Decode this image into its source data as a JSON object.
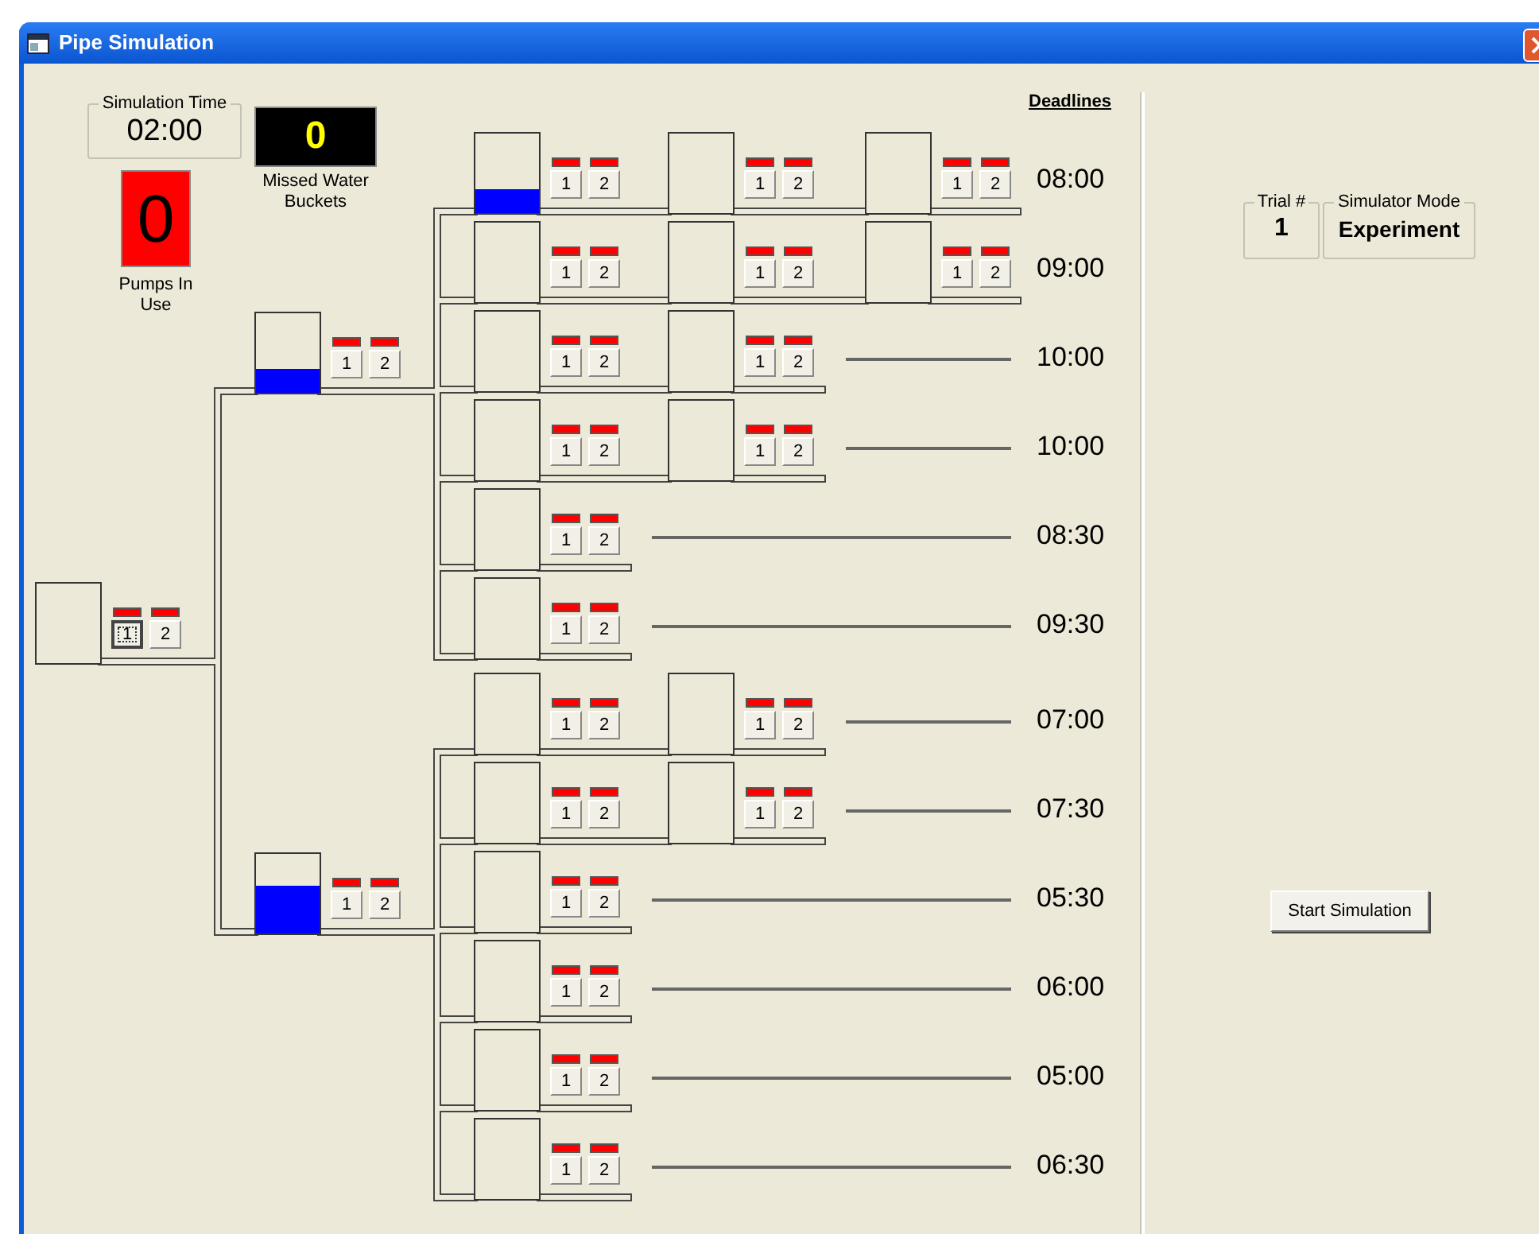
{
  "window": {
    "title": "Pipe Simulation"
  },
  "simulation_time": {
    "label": "Simulation Time",
    "value": "02:00"
  },
  "missed_water_buckets": {
    "value": "0",
    "label": "Missed Water Buckets"
  },
  "pumps_in_use": {
    "value": "0",
    "label": "Pumps In Use"
  },
  "deadlines_header": "Deadlines",
  "network": {
    "level": 0,
    "pumps": [
      {
        "label": "1",
        "running": false,
        "focused": true
      },
      {
        "label": "2",
        "running": false,
        "focused": false
      }
    ],
    "children": [
      {
        "level": 0.3,
        "pumps": [
          {
            "label": "1",
            "running": false,
            "focused": false
          },
          {
            "label": "2",
            "running": false,
            "focused": false
          }
        ],
        "children": [
          {
            "level": 0.3,
            "deadline": "08:00",
            "pumps": [
              {
                "label": "1",
                "running": false,
                "focused": false
              },
              {
                "label": "2",
                "running": false,
                "focused": false
              }
            ],
            "children": [
              {
                "level": 0,
                "pumps": [
                  {
                    "label": "1",
                    "running": false,
                    "focused": false
                  },
                  {
                    "label": "2",
                    "running": false,
                    "focused": false
                  }
                ],
                "children": [
                  {
                    "level": 0,
                    "pumps": [
                      {
                        "label": "1",
                        "running": false,
                        "focused": false
                      },
                      {
                        "label": "2",
                        "running": false,
                        "focused": false
                      }
                    ]
                  }
                ]
              }
            ]
          },
          {
            "level": 0,
            "deadline": "09:00",
            "pumps": [
              {
                "label": "1",
                "running": false,
                "focused": false
              },
              {
                "label": "2",
                "running": false,
                "focused": false
              }
            ],
            "children": [
              {
                "level": 0,
                "pumps": [
                  {
                    "label": "1",
                    "running": false,
                    "focused": false
                  },
                  {
                    "label": "2",
                    "running": false,
                    "focused": false
                  }
                ],
                "children": [
                  {
                    "level": 0,
                    "pumps": [
                      {
                        "label": "1",
                        "running": false,
                        "focused": false
                      },
                      {
                        "label": "2",
                        "running": false,
                        "focused": false
                      }
                    ]
                  }
                ]
              }
            ]
          },
          {
            "level": 0,
            "deadline": "10:00",
            "pumps": [
              {
                "label": "1",
                "running": false,
                "focused": false
              },
              {
                "label": "2",
                "running": false,
                "focused": false
              }
            ],
            "children": [
              {
                "level": 0,
                "pumps": [
                  {
                    "label": "1",
                    "running": false,
                    "focused": false
                  },
                  {
                    "label": "2",
                    "running": false,
                    "focused": false
                  }
                ]
              }
            ]
          },
          {
            "level": 0,
            "deadline": "10:00",
            "pumps": [
              {
                "label": "1",
                "running": false,
                "focused": false
              },
              {
                "label": "2",
                "running": false,
                "focused": false
              }
            ],
            "children": [
              {
                "level": 0,
                "pumps": [
                  {
                    "label": "1",
                    "running": false,
                    "focused": false
                  },
                  {
                    "label": "2",
                    "running": false,
                    "focused": false
                  }
                ]
              }
            ]
          },
          {
            "level": 0,
            "deadline": "08:30",
            "pumps": [
              {
                "label": "1",
                "running": false,
                "focused": false
              },
              {
                "label": "2",
                "running": false,
                "focused": false
              }
            ]
          },
          {
            "level": 0,
            "deadline": "09:30",
            "pumps": [
              {
                "label": "1",
                "running": false,
                "focused": false
              },
              {
                "label": "2",
                "running": false,
                "focused": false
              }
            ]
          }
        ]
      },
      {
        "level": 0.6,
        "pumps": [
          {
            "label": "1",
            "running": false,
            "focused": false
          },
          {
            "label": "2",
            "running": false,
            "focused": false
          }
        ],
        "children": [
          {
            "level": 0,
            "deadline": "07:00",
            "pumps": [
              {
                "label": "1",
                "running": false,
                "focused": false
              },
              {
                "label": "2",
                "running": false,
                "focused": false
              }
            ],
            "children": [
              {
                "level": 0,
                "pumps": [
                  {
                    "label": "1",
                    "running": false,
                    "focused": false
                  },
                  {
                    "label": "2",
                    "running": false,
                    "focused": false
                  }
                ]
              }
            ]
          },
          {
            "level": 0,
            "deadline": "07:30",
            "pumps": [
              {
                "label": "1",
                "running": false,
                "focused": false
              },
              {
                "label": "2",
                "running": false,
                "focused": false
              }
            ],
            "children": [
              {
                "level": 0,
                "pumps": [
                  {
                    "label": "1",
                    "running": false,
                    "focused": false
                  },
                  {
                    "label": "2",
                    "running": false,
                    "focused": false
                  }
                ]
              }
            ]
          },
          {
            "level": 0,
            "deadline": "05:30",
            "pumps": [
              {
                "label": "1",
                "running": false,
                "focused": false
              },
              {
                "label": "2",
                "running": false,
                "focused": false
              }
            ]
          },
          {
            "level": 0,
            "deadline": "06:00",
            "pumps": [
              {
                "label": "1",
                "running": false,
                "focused": false
              },
              {
                "label": "2",
                "running": false,
                "focused": false
              }
            ]
          },
          {
            "level": 0,
            "deadline": "05:00",
            "pumps": [
              {
                "label": "1",
                "running": false,
                "focused": false
              },
              {
                "label": "2",
                "running": false,
                "focused": false
              }
            ]
          },
          {
            "level": 0,
            "deadline": "06:30",
            "pumps": [
              {
                "label": "1",
                "running": false,
                "focused": false
              },
              {
                "label": "2",
                "running": false,
                "focused": false
              }
            ]
          }
        ]
      }
    ]
  },
  "trial": {
    "label": "Trial #",
    "value": "1"
  },
  "simulator_mode": {
    "label": "Simulator Mode",
    "value": "Experiment"
  },
  "start_button": "Start Simulation"
}
